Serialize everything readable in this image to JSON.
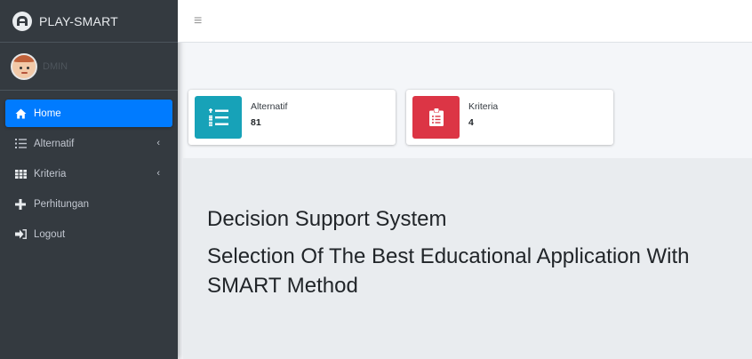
{
  "brand": {
    "name": "PLAY-SMART"
  },
  "user": {
    "name": "DMIN"
  },
  "sidebar": {
    "items": [
      {
        "label": "Home",
        "icon": "home-icon",
        "active": true
      },
      {
        "label": "Alternatif",
        "icon": "list-ol-icon",
        "has_submenu": true
      },
      {
        "label": "Kriteria",
        "icon": "table-icon",
        "has_submenu": true
      },
      {
        "label": "Perhitungan",
        "icon": "plus-icon"
      },
      {
        "label": "Logout",
        "icon": "sign-out-icon"
      }
    ],
    "chevron": "‹"
  },
  "topbar": {
    "menu_icon": "≡"
  },
  "info_boxes": [
    {
      "label": "Alternatif",
      "value": "81",
      "color": "#17a2b8",
      "icon": "list-ol-icon"
    },
    {
      "label": "Kriteria",
      "value": "4",
      "color": "#dc3545",
      "icon": "clipboard-list-icon"
    }
  ],
  "jumbotron": {
    "title": "Decision Support System",
    "subtitle": "Selection Of The Best Educational Application With SMART Method"
  },
  "colors": {
    "sidebar": "#343a40",
    "active": "#007bff",
    "content_bg": "#f4f6f9"
  }
}
